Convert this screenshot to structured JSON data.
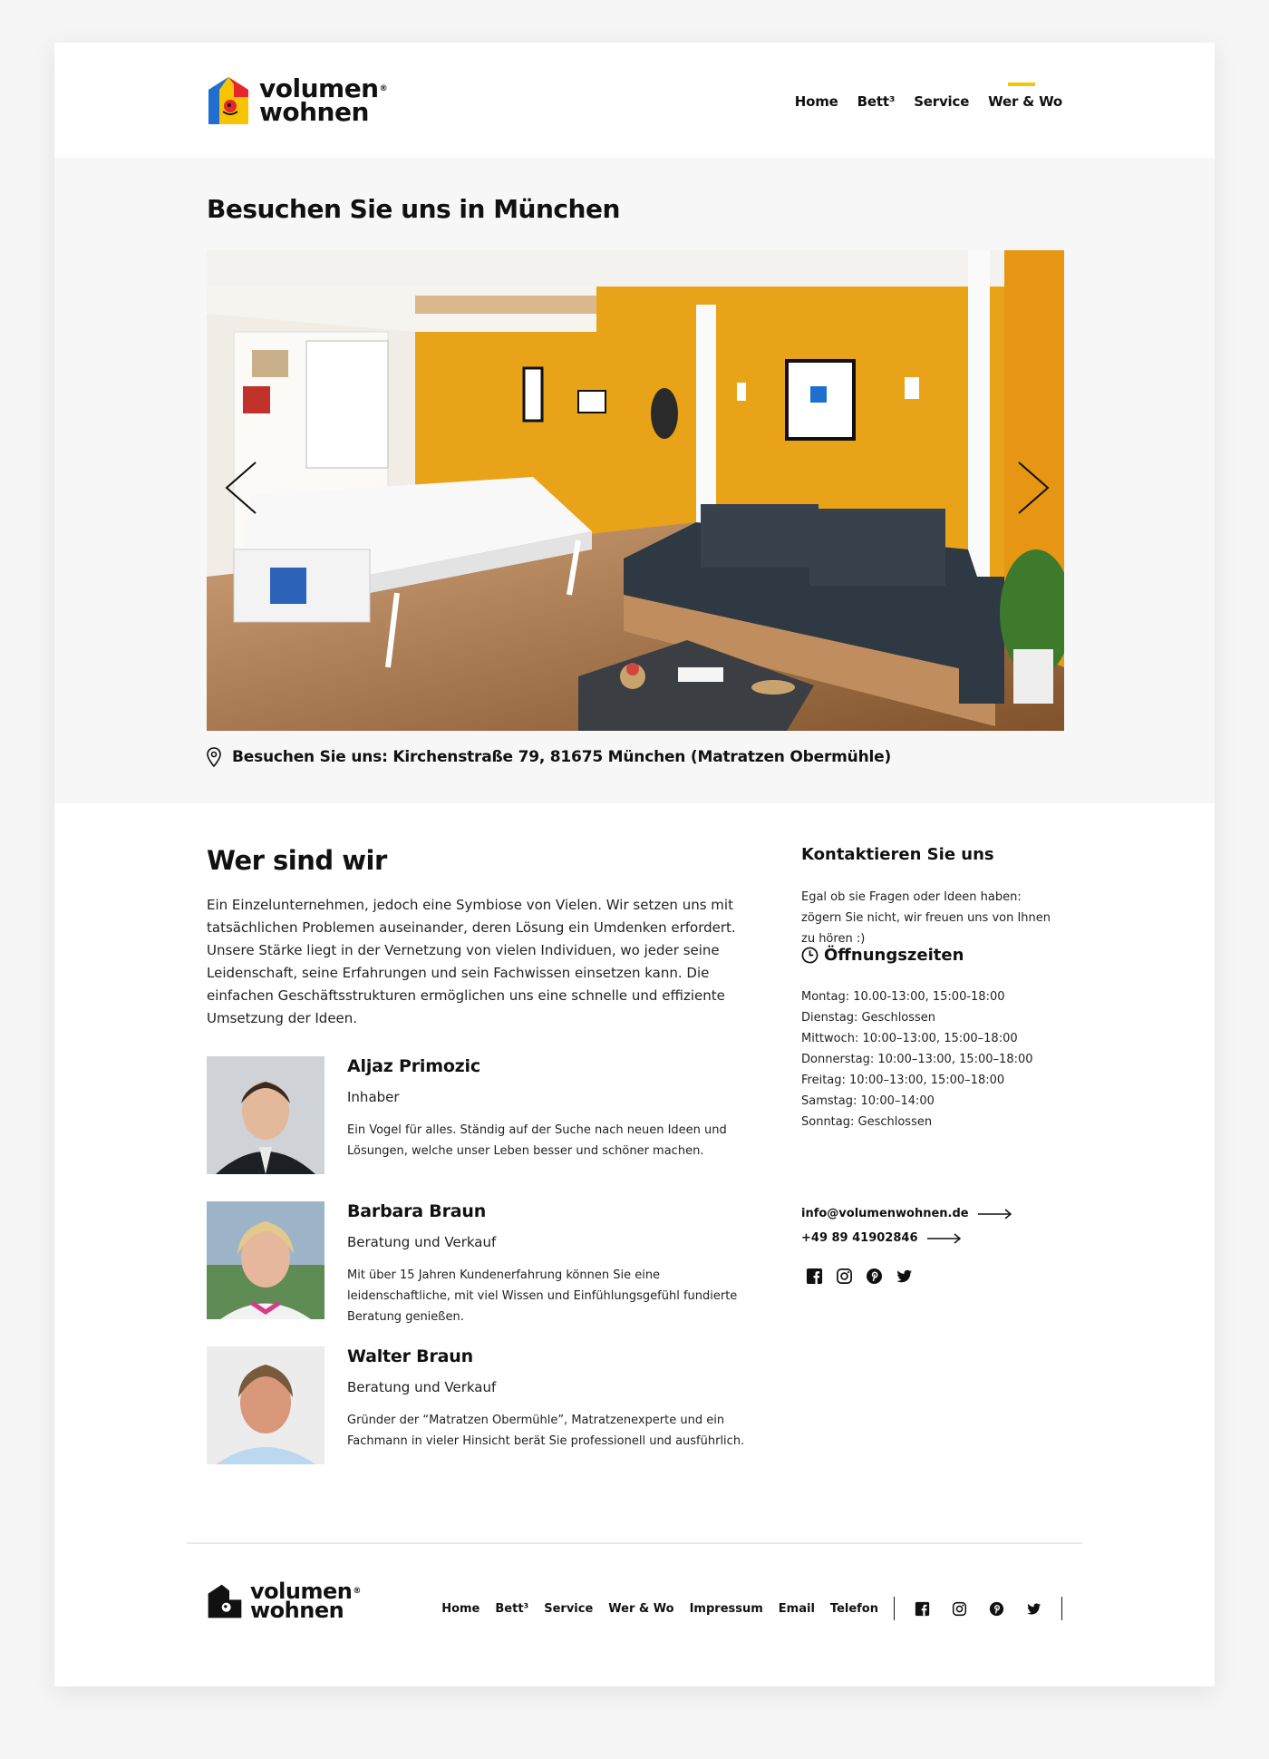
{
  "brand": {
    "logo_text_line1": "volumen",
    "logo_text_line2": "wohnen",
    "registered": "®",
    "accent_color": "#f7c400"
  },
  "nav": {
    "items": [
      {
        "label": "Home"
      },
      {
        "label": "Bett³"
      },
      {
        "label": "Service"
      },
      {
        "label": "Wer & Wo",
        "active": true
      }
    ]
  },
  "visit": {
    "title": "Besuchen Sie uns in München",
    "slider_icons": {
      "prev": "chevron-left-icon",
      "next": "chevron-right-icon"
    },
    "address_icon": "location-pin-icon",
    "address": "Besuchen Sie uns: Kirchenstraße 79, 81675 München (Matratzen Obermühle)"
  },
  "about": {
    "title": "Wer sind wir",
    "intro": "Ein Einzelunternehmen, jedoch eine Symbiose von Vielen. Wir setzen uns mit tatsächlichen Problemen auseinander, deren Lösung ein Umdenken erfordert. Unsere Stärke liegt in der Vernetzung von vielen Individuen, wo jeder seine Leidenschaft, seine Erfahrungen und sein Fachwissen einsetzen kann. Die einfachen Geschäftsstrukturen ermöglichen uns eine schnelle und effiziente Umsetzung der Ideen.",
    "team": [
      {
        "name": "Aljaz Primozic",
        "role": "Inhaber",
        "description": "Ein Vogel für alles. Ständig auf der Suche nach neuen Ideen und Lösungen, welche unser Leben besser und schöner machen."
      },
      {
        "name": "Barbara Braun",
        "role": "Beratung und Verkauf",
        "description": "Mit über 15 Jahren Kundenerfahrung können Sie eine leidenschaftliche, mit viel Wissen und Einfühlungsgefühl fundierte Beratung genießen."
      },
      {
        "name": "Walter Braun",
        "role": "Beratung und Verkauf",
        "description": "Gründer der “Matratzen Obermühle”, Matratzenexperte und ein Fachmann in vieler Hinsicht berät Sie professionell und ausführlich."
      }
    ]
  },
  "contact": {
    "title": "Kontaktieren Sie uns",
    "lead": "Egal ob sie Fragen oder Ideen haben: zögern Sie nicht, wir freuen uns von Ihnen zu hören :)",
    "hours_title": "Öffnungszeiten",
    "hours_icon": "clock-icon",
    "hours": [
      "Montag: 10.00-13:00, 15:00-18:00",
      "Dienstag: Geschlossen",
      "Mittwoch: 10:00–13:00, 15:00–18:00",
      "Donnerstag: 10:00–13:00, 15:00–18:00",
      "Freitag: 10:00–13:00, 15:00–18:00",
      "Samstag: 10:00–14:00",
      "Sonntag: Geschlossen"
    ],
    "email": "info@volumenwohnen.de",
    "phone": "+49 89 41902846",
    "socials": [
      "facebook-icon",
      "instagram-icon",
      "pinterest-icon",
      "twitter-icon"
    ]
  },
  "footer": {
    "nav": [
      "Home",
      "Bett³",
      "Service",
      "Wer & Wo",
      "Impressum",
      "Email",
      "Telefon"
    ]
  }
}
